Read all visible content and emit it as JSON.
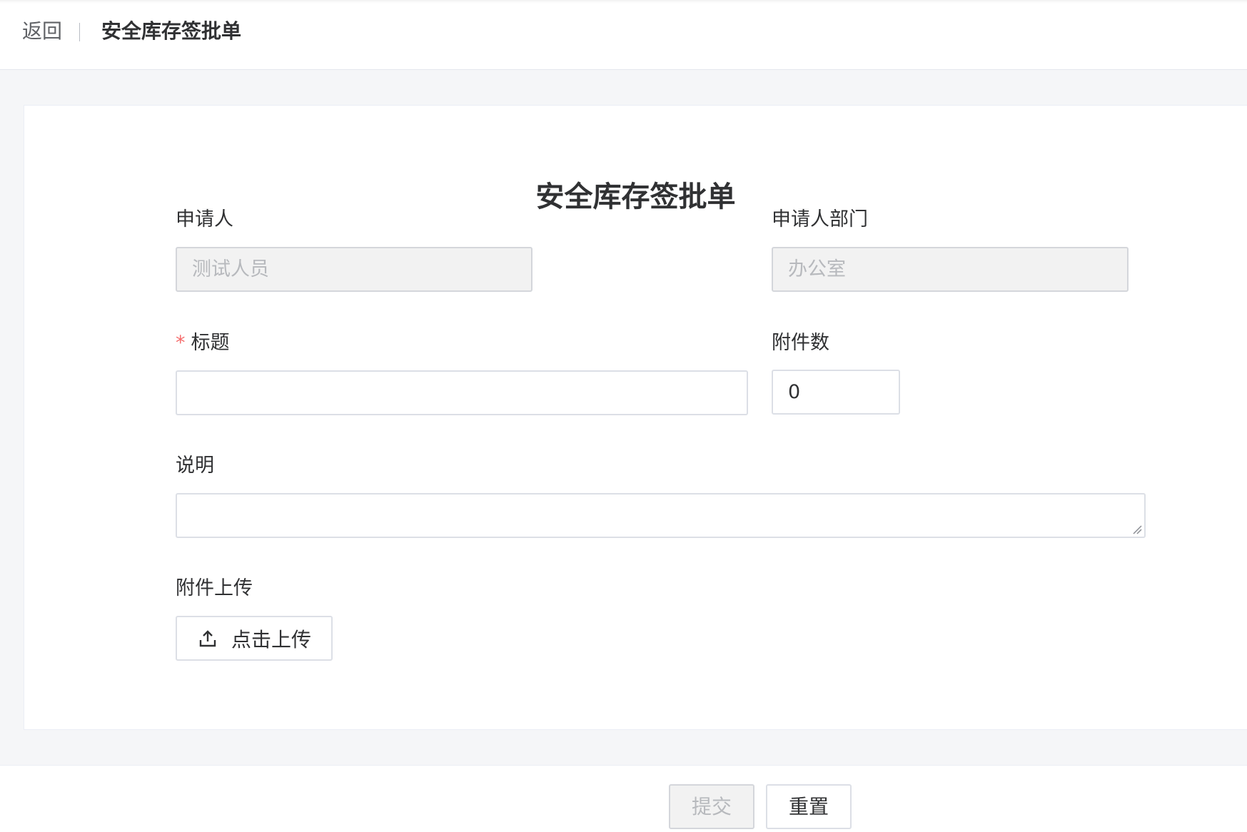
{
  "header": {
    "back_label": "返回",
    "title": "安全库存签批单"
  },
  "form": {
    "title": "安全库存签批单",
    "applicant": {
      "label": "申请人",
      "value": "测试人员",
      "disabled": true
    },
    "department": {
      "label": "申请人部门",
      "value": "办公室",
      "disabled": true
    },
    "subject": {
      "label": "标题",
      "required_mark": "*",
      "value": ""
    },
    "attachment_count": {
      "label": "附件数",
      "value": "0"
    },
    "description": {
      "label": "说明",
      "value": ""
    },
    "upload": {
      "label": "附件上传",
      "button_label": "点击上传"
    }
  },
  "footer": {
    "submit_label": "提交",
    "submit_disabled": true,
    "reset_label": "重置"
  },
  "colors": {
    "page_background": "#f5f6f8",
    "required": "#f56c6c",
    "border": "#dcdfe6",
    "disabled_background": "#f2f2f2",
    "disabled_text": "#b7b9bd"
  },
  "icons": {
    "upload": "upload-icon",
    "resize": "resize-grip-icon"
  }
}
